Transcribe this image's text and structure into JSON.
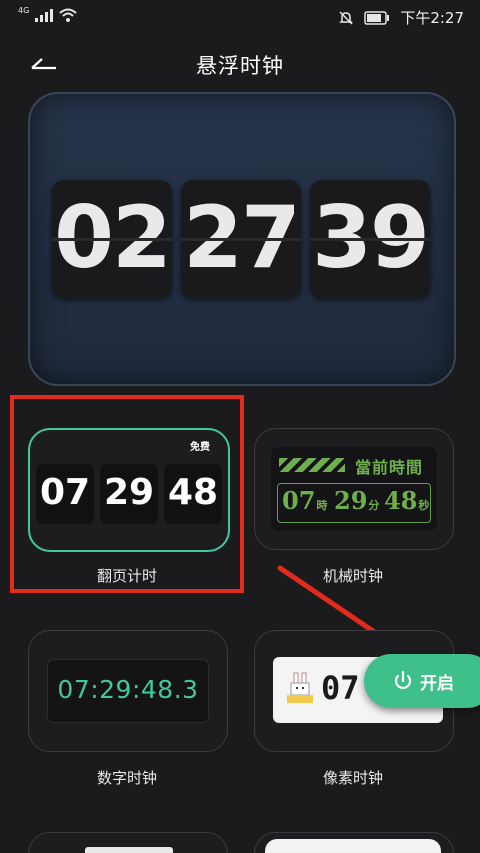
{
  "status_bar": {
    "network": "4G",
    "time": "下午2:27"
  },
  "header": {
    "title": "悬浮时钟"
  },
  "preview": {
    "hours": "02",
    "minutes": "27",
    "seconds": "39"
  },
  "cards": {
    "flip": {
      "label": "翻页计时",
      "badge": "免费",
      "hours": "07",
      "minutes": "29",
      "seconds": "48"
    },
    "mechanical": {
      "label": "机械时钟",
      "title": "當前時間",
      "hours": "07",
      "h_unit": "時",
      "minutes": "29",
      "m_unit": "分",
      "seconds": "48",
      "s_unit": "秒"
    },
    "digital": {
      "label": "数字时钟",
      "time": "07:29:48.3"
    },
    "pixel": {
      "label": "像素时钟",
      "time": "07"
    }
  },
  "open_button": {
    "label": "开启"
  },
  "colors": {
    "accent": "#3fbf8a",
    "selected_border": "#43c7a1",
    "highlight": "#e02b1d",
    "arrow": "#e02b1d"
  }
}
